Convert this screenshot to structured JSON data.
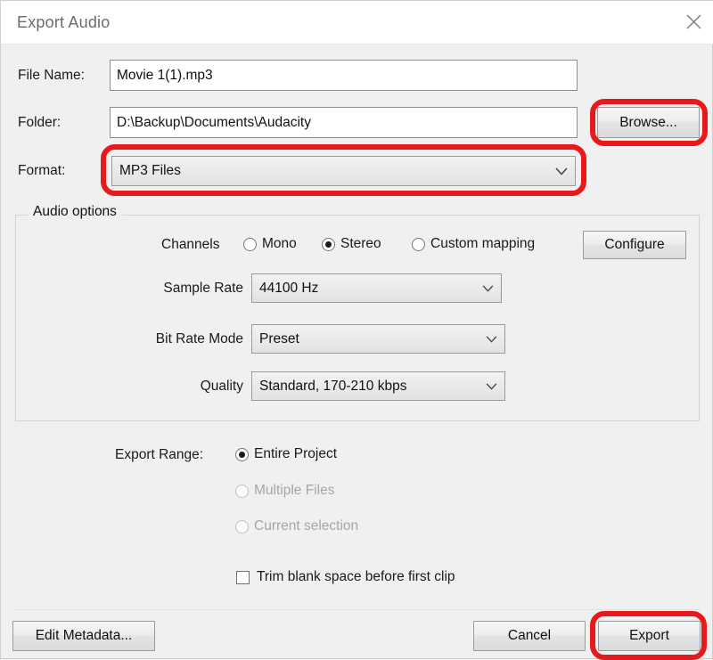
{
  "window": {
    "title": "Export Audio",
    "close_icon": "close-icon"
  },
  "fields": {
    "file_name_label": "File Name:",
    "file_name_value": "Movie 1(1).mp3",
    "folder_label": "Folder:",
    "folder_value": "D:\\Backup\\Documents\\Audacity",
    "browse_label": "Browse...",
    "format_label": "Format:",
    "format_value": "MP3 Files"
  },
  "audio_options": {
    "group_title": "Audio options",
    "channels_label": "Channels",
    "channels": [
      {
        "label": "Mono",
        "selected": false,
        "disabled": false
      },
      {
        "label": "Stereo",
        "selected": true,
        "disabled": false
      },
      {
        "label": "Custom mapping",
        "selected": false,
        "disabled": false
      }
    ],
    "configure_label": "Configure",
    "sample_rate_label": "Sample Rate",
    "sample_rate_value": "44100 Hz",
    "bit_rate_mode_label": "Bit Rate Mode",
    "bit_rate_mode_value": "Preset",
    "quality_label": "Quality",
    "quality_value": "Standard, 170-210 kbps"
  },
  "export_range": {
    "label": "Export Range:",
    "options": [
      {
        "label": "Entire Project",
        "selected": true,
        "disabled": false
      },
      {
        "label": "Multiple Files",
        "selected": false,
        "disabled": true
      },
      {
        "label": "Current selection",
        "selected": false,
        "disabled": true
      }
    ]
  },
  "trim": {
    "label": "Trim blank space before first clip",
    "checked": false
  },
  "footer": {
    "edit_metadata_label": "Edit Metadata...",
    "cancel_label": "Cancel",
    "export_label": "Export"
  },
  "annotations": {
    "highlight_color": "#e8191b",
    "highlighted": [
      "browse-button",
      "format-combobox",
      "export-button"
    ]
  }
}
